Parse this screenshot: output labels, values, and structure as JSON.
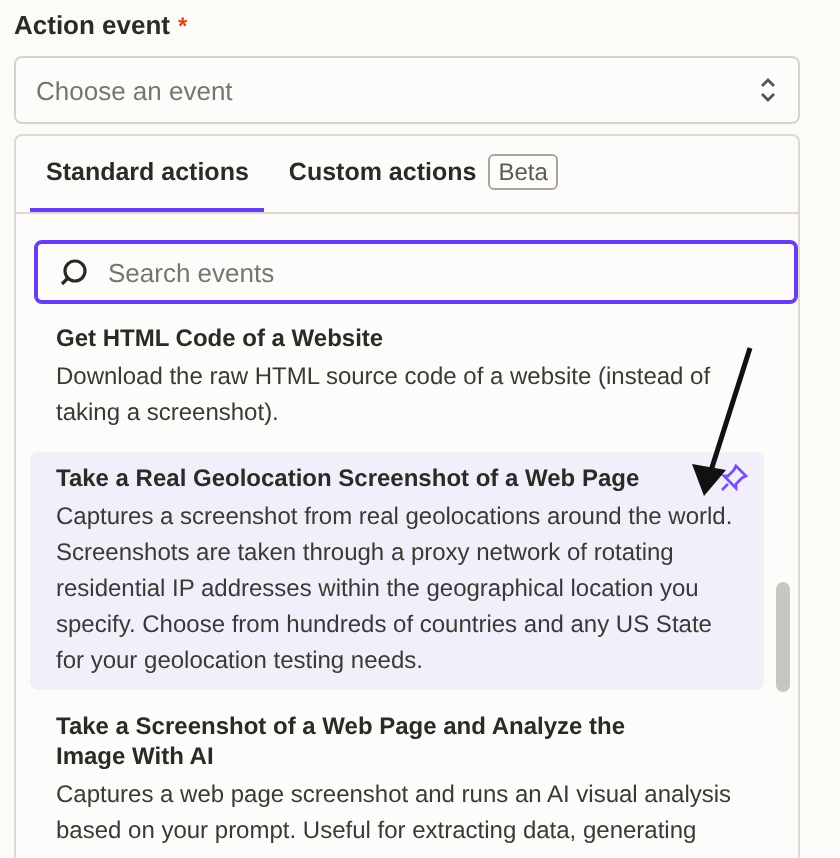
{
  "field": {
    "label": "Action event",
    "required_mark": "*",
    "placeholder": "Choose an event"
  },
  "tabs": [
    {
      "label": "Standard actions",
      "selected": true
    },
    {
      "label": "Custom actions",
      "selected": false,
      "badge": "Beta"
    }
  ],
  "search": {
    "placeholder": "Search events"
  },
  "events": [
    {
      "title": "Get HTML Code of a Website",
      "description": "Download the raw HTML source code of a website (instead of taking a screenshot).",
      "highlighted": false,
      "pinned": false
    },
    {
      "title": "Take a Real Geolocation Screenshot of a Web Page",
      "description": "Captures a screenshot from real geolocations around the world. Screenshots are taken through a proxy network of rotating residential IP addresses within the geographical location you specify. Choose from hundreds of countries and any US State for your geolocation testing needs.",
      "highlighted": true,
      "pinned": true
    },
    {
      "title": "Take a Screenshot of a Web Page and Analyze the Image With AI",
      "description": "Captures a web page screenshot and runs an AI visual analysis based on your prompt. Useful for extracting data, generating",
      "highlighted": false,
      "pinned": false
    }
  ]
}
